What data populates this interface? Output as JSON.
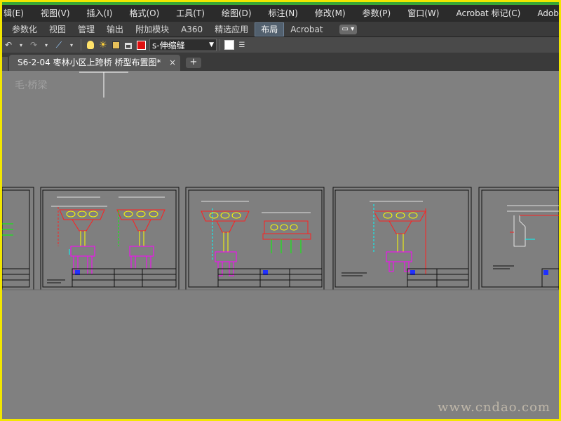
{
  "menu": {
    "items": [
      "辑(E)",
      "视图(V)",
      "插入(I)",
      "格式(O)",
      "工具(T)",
      "绘图(D)",
      "标注(N)",
      "修改(M)",
      "参数(P)",
      "窗口(W)",
      "Acrobat 标记(C)",
      "Adobe P"
    ]
  },
  "ribbon": {
    "tabs": [
      "参数化",
      "视图",
      "管理",
      "输出",
      "附加模块",
      "A360",
      "精选应用",
      "布局",
      "Acrobat"
    ],
    "active": "布局"
  },
  "toolbar": {
    "layer_name": "s-伸缩缝"
  },
  "document": {
    "tab_title": "S6-2-04 枣林小区上跨桥 桥型布置图*",
    "close": "×",
    "add": "+"
  },
  "watermark": {
    "top": "毛·桥梁",
    "bottom": "www.cndao.com"
  },
  "colors": {
    "frame": "#f2e600",
    "canvas": "#808080",
    "sheet": "#7f7f7f",
    "red": "#ff2020",
    "yellow": "#ffff00",
    "cyan": "#00ffff",
    "magenta": "#ff00ff",
    "green": "#00ff00",
    "blue": "#2030ff"
  }
}
